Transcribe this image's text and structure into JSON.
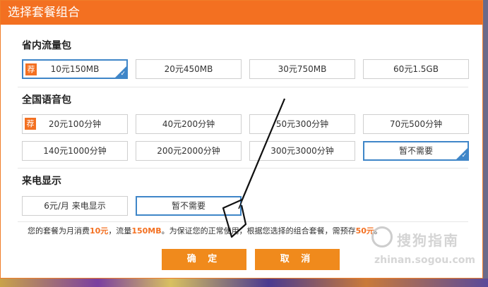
{
  "dialog": {
    "title": "选择套餐组合"
  },
  "sections": {
    "data_pack": {
      "title": "省内流量包",
      "options": [
        "10元150MB",
        "20元450MB",
        "30元750MB",
        "60元1.5GB"
      ]
    },
    "voice_pack": {
      "title": "全国语音包",
      "options": [
        "20元100分钟",
        "40元200分钟",
        "50元300分钟",
        "70元500分钟",
        "140元1000分钟",
        "200元2000分钟",
        "300元3000分钟",
        "暂不需要"
      ]
    },
    "caller_id": {
      "title": "来电显示",
      "options": [
        "6元/月 来电显示",
        "暂不需要"
      ]
    }
  },
  "badge_text": "荐",
  "summary": {
    "prefix": "您的套餐为月消费",
    "monthly": "10元",
    "mid1": "，流量",
    "data": "150MB",
    "mid2": "。为保证您的正常使用，根据您选择的组合套餐，需预存",
    "deposit": "50元",
    "suffix": "。"
  },
  "buttons": {
    "confirm": "确 定",
    "cancel": "取 消"
  },
  "watermark": {
    "text": "搜狗指南",
    "url": "zhinan.sogou.com"
  },
  "colors": {
    "accent": "#f37021",
    "selected_border": "#3f86c8",
    "button": "#f08a1c"
  }
}
